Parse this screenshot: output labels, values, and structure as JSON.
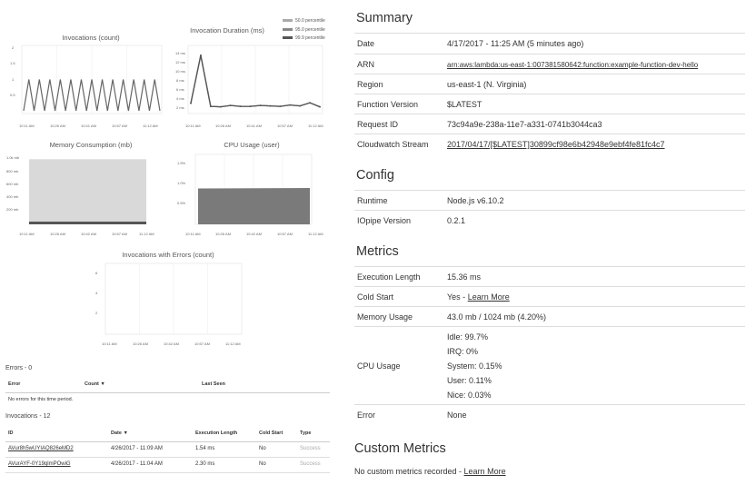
{
  "charts": {
    "invocations_count": {
      "title": "Invocations (count)",
      "y_ticks": [
        "2",
        "1.5",
        "1",
        "0.5"
      ],
      "x_ticks": [
        "10:11 AM",
        "10:26 AM",
        "10:41 AM",
        "10:57 AM",
        "11:12 AM"
      ]
    },
    "invocation_duration": {
      "title": "Invocation Duration (ms)",
      "y_ticks": [
        "14 ms",
        "12 ms",
        "10 ms",
        "8 ms",
        "6 ms",
        "4 ms",
        "2 ms"
      ],
      "x_ticks": [
        "10:11 AM",
        "10:26 AM",
        "10:41 AM",
        "10:57 AM",
        "11:12 AM"
      ],
      "legend": [
        "50.0 percentile",
        "95.0 percentile",
        "99.9 percentile"
      ]
    },
    "memory": {
      "title": "Memory Consumption (mb)",
      "y_ticks": [
        "1.0k mb",
        "800 mb",
        "600 mb",
        "400 mb",
        "200 mb"
      ],
      "x_ticks": [
        "10:11 AM",
        "10:26 AM",
        "10:42 AM",
        "10:57 AM",
        "11:12 AM"
      ]
    },
    "cpu": {
      "title": "CPU Usage (user)",
      "y_ticks": [
        "1.5%",
        "1.0%",
        "0.5%"
      ],
      "x_ticks": [
        "10:11 AM",
        "10:26 AM",
        "10:42 AM",
        "10:57 AM",
        "11:12 AM"
      ]
    },
    "errors": {
      "title": "Invocations with Errors (count)",
      "y_ticks": [
        "6",
        "4",
        "2"
      ],
      "x_ticks": [
        "10:11 AM",
        "10:26 AM",
        "10:42 AM",
        "10:57 AM",
        "11:12 AM"
      ]
    }
  },
  "chart_data": [
    {
      "type": "line",
      "title": "Invocations (count)",
      "categories": [
        "10:11 AM",
        "10:26 AM",
        "10:41 AM",
        "10:57 AM",
        "11:12 AM"
      ],
      "ylim": [
        0,
        2
      ],
      "series": [
        {
          "values": [
            0,
            1,
            0,
            1,
            0,
            1,
            0,
            1,
            0,
            1,
            0,
            1,
            0,
            1,
            0,
            1,
            0,
            1,
            0,
            1,
            0,
            1,
            0,
            1,
            0,
            1,
            0
          ]
        }
      ]
    },
    {
      "type": "line",
      "title": "Invocation Duration (ms)",
      "categories": [
        "10:11 AM",
        "10:26 AM",
        "10:41 AM",
        "10:57 AM",
        "11:12 AM"
      ],
      "ylim": [
        0,
        14
      ],
      "series": [
        {
          "name": "50.0 percentile",
          "values": [
            2.3,
            13,
            1.6,
            1.5,
            1.8,
            1.6,
            1.6,
            1.8,
            1.7,
            1.6,
            1.9,
            1.7,
            2.4,
            1.5
          ]
        },
        {
          "name": "95.0 percentile",
          "values": [
            2.3,
            13,
            1.6,
            1.5,
            1.8,
            1.6,
            1.6,
            1.8,
            1.7,
            1.6,
            1.9,
            1.7,
            2.4,
            1.5
          ]
        },
        {
          "name": "99.9 percentile",
          "values": [
            2.3,
            13,
            1.6,
            1.5,
            1.8,
            1.6,
            1.6,
            1.8,
            1.7,
            1.6,
            1.9,
            1.7,
            2.4,
            1.5
          ]
        }
      ]
    },
    {
      "type": "area",
      "title": "Memory Consumption (mb)",
      "categories": [
        "10:11 AM",
        "10:26 AM",
        "10:42 AM",
        "10:57 AM",
        "11:12 AM"
      ],
      "ylim": [
        0,
        1100
      ],
      "series": [
        {
          "name": "allocated",
          "values": [
            1024,
            1024
          ]
        },
        {
          "name": "used",
          "values": [
            43,
            43
          ]
        }
      ]
    },
    {
      "type": "area",
      "title": "CPU Usage (user)",
      "categories": [
        "10:11 AM",
        "10:26 AM",
        "10:42 AM",
        "10:57 AM",
        "11:12 AM"
      ],
      "ylim": [
        0,
        1.6
      ],
      "series": [
        {
          "values": [
            0.82,
            0.83
          ]
        }
      ]
    },
    {
      "type": "line",
      "title": "Invocations with Errors (count)",
      "categories": [
        "10:11 AM",
        "10:26 AM",
        "10:42 AM",
        "10:57 AM",
        "11:12 AM"
      ],
      "ylim": [
        0,
        7
      ],
      "series": [
        {
          "values": []
        }
      ]
    }
  ],
  "colors": {
    "series_50": "#aaaaaa",
    "series_95": "#888888",
    "series_99": "#555555",
    "line": "#666666",
    "memory_fill": "#d9d9d9",
    "memory_used": "#555555",
    "cpu_fill": "#7a7a7a"
  },
  "errors_table": {
    "title": "Errors - 0",
    "headers": [
      "Error",
      "Count ▼",
      "Last Seen"
    ],
    "empty": "No errors for this time period."
  },
  "invocations_table": {
    "title": "Invocations - 12",
    "headers": [
      "ID",
      "Date ▼",
      "Execution Length",
      "Cold Start",
      "Type"
    ],
    "rows": [
      {
        "id": "AVur8h5wUYIAQ826eMD2",
        "date": "4/26/2017 - 11:09 AM",
        "length": "1.54 ms",
        "cold": "No",
        "type": "Success"
      },
      {
        "id": "AVurAYF-0Y19qlmPOwiG",
        "date": "4/26/2017 - 11:04 AM",
        "length": "2.30 ms",
        "cold": "No",
        "type": "Success"
      }
    ]
  },
  "summary": {
    "title": "Summary",
    "rows": [
      {
        "key": "Date",
        "value": "4/17/2017 - 11:25 AM (5 minutes ago)"
      },
      {
        "key": "ARN",
        "value": "arn:aws:lambda:us-east-1:007381580642:function:example-function-dev-hello"
      },
      {
        "key": "Region",
        "value": "us-east-1 (N. Virginia)"
      },
      {
        "key": "Function Version",
        "value": "$LATEST"
      },
      {
        "key": "Request ID",
        "value": "73c94a9e-238a-11e7-a331-0741b3044ca3"
      },
      {
        "key": "Cloudwatch Stream",
        "value": "2017/04/17/[$LATEST]30899cf98e6b42948e9ebf4fe81fc4c7"
      }
    ]
  },
  "config": {
    "title": "Config",
    "rows": [
      {
        "key": "Runtime",
        "value": "Node.js v6.10.2"
      },
      {
        "key": "IOpipe Version",
        "value": "0.2.1"
      }
    ]
  },
  "metrics": {
    "title": "Metrics",
    "execution_length": {
      "key": "Execution Length",
      "value": "15.36 ms"
    },
    "cold_start": {
      "key": "Cold Start",
      "value": "Yes - ",
      "link": "Learn More"
    },
    "memory_usage": {
      "key": "Memory Usage",
      "value": "43.0 mb / 1024 mb (4.20%)"
    },
    "cpu_usage": {
      "key": "CPU Usage",
      "lines": [
        "Idle: 99.7%",
        "IRQ: 0%",
        "System: 0.15%",
        "User: 0.11%",
        "Nice: 0.03%"
      ]
    },
    "error": {
      "key": "Error",
      "value": "None"
    }
  },
  "custom_metrics": {
    "title": "Custom Metrics",
    "text": "No custom metrics recorded - ",
    "link": "Learn More"
  }
}
